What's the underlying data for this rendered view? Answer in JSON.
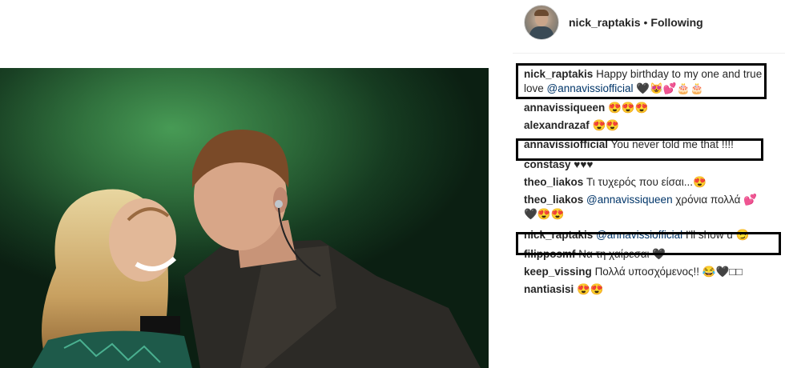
{
  "post": {
    "author": "nick_raptakis",
    "separator": "•",
    "follow_status": "Following",
    "photo_alt": "photo-of-couple-on-stage"
  },
  "comments": [
    {
      "user": "nick_raptakis",
      "pre": "Happy birthday to my one and true love",
      "mention": "@annavissiofficial",
      "post": "🖤😻💕🎂🎂"
    },
    {
      "user": "annavissiqueen",
      "pre": "😍😍😍",
      "mention": "",
      "post": ""
    },
    {
      "user": "alexandrazaf",
      "pre": "😍😍",
      "mention": "",
      "post": ""
    },
    {
      "user": "annavissiofficial",
      "pre": "You never told me that !!!!",
      "mention": "",
      "post": ""
    },
    {
      "user": "constasy",
      "pre": "♥♥♥",
      "mention": "",
      "post": ""
    },
    {
      "user": "theo_liakos",
      "pre": "Τι τυχερός που είσαι...😍",
      "mention": "",
      "post": ""
    },
    {
      "user": "theo_liakos",
      "pre": "",
      "mention": "@annavissiqueen",
      "post": "χρόνια πολλά 💕🖤😍😍"
    },
    {
      "user": "nick_raptakis",
      "pre": "",
      "mention": "@annavissiofficial",
      "post": "I'll show u 😏"
    },
    {
      "user": "filipposmf",
      "pre": "Να τη χαίρεσαι 🖤",
      "mention": "",
      "post": ""
    },
    {
      "user": "keep_vissing",
      "pre": "Πολλά υποσχόμενος!! 😂🖤□□",
      "mention": "",
      "post": ""
    },
    {
      "user": "nantiasisi",
      "pre": "😍😍",
      "mention": "",
      "post": ""
    }
  ],
  "colors": {
    "mention": "#003569",
    "text": "#262626",
    "highlight_border": "#000000"
  }
}
